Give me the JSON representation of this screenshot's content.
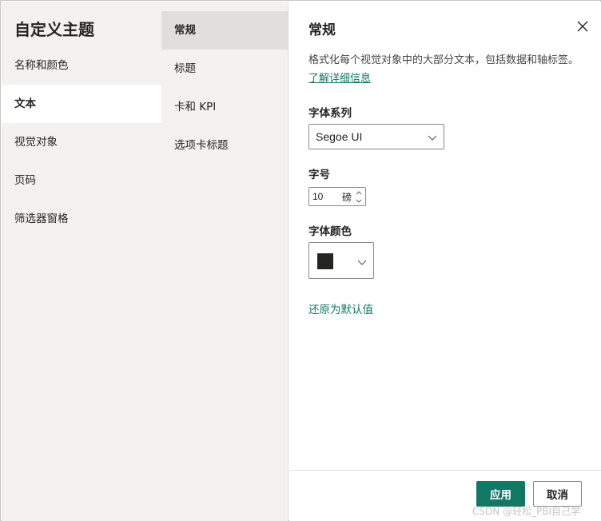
{
  "dialog": {
    "title": "自定义主题"
  },
  "nav1": {
    "items": [
      {
        "label": "名称和颜色"
      },
      {
        "label": "文本"
      },
      {
        "label": "视觉对象"
      },
      {
        "label": "页码"
      },
      {
        "label": "筛选器窗格"
      }
    ],
    "active_index": 1
  },
  "nav2": {
    "items": [
      {
        "label": "常规"
      },
      {
        "label": "标题"
      },
      {
        "label": "卡和 KPI"
      },
      {
        "label": "选项卡标题"
      }
    ],
    "active_index": 0
  },
  "main": {
    "title": "常规",
    "description": "格式化每个视觉对象中的大部分文本，包括数据和轴标签。",
    "learn_more": "了解详细信息",
    "font_family": {
      "label": "字体系列",
      "value": "Segoe UI"
    },
    "font_size": {
      "label": "字号",
      "value": "10",
      "unit": "磅"
    },
    "font_color": {
      "label": "字体颜色",
      "value": "#252423"
    },
    "reset_label": "还原为默认值"
  },
  "footer": {
    "apply_label": "应用",
    "cancel_label": "取消"
  },
  "icons": {
    "close": "close-icon",
    "chevron": "chevron-down-icon",
    "up": "chevron-up-icon"
  },
  "colors": {
    "accent": "#117865",
    "nav_bg": "#f3f2f1",
    "nav_active_bg": "#e1dfdd"
  },
  "watermark": "CSDN @轻松_PBI自己学"
}
